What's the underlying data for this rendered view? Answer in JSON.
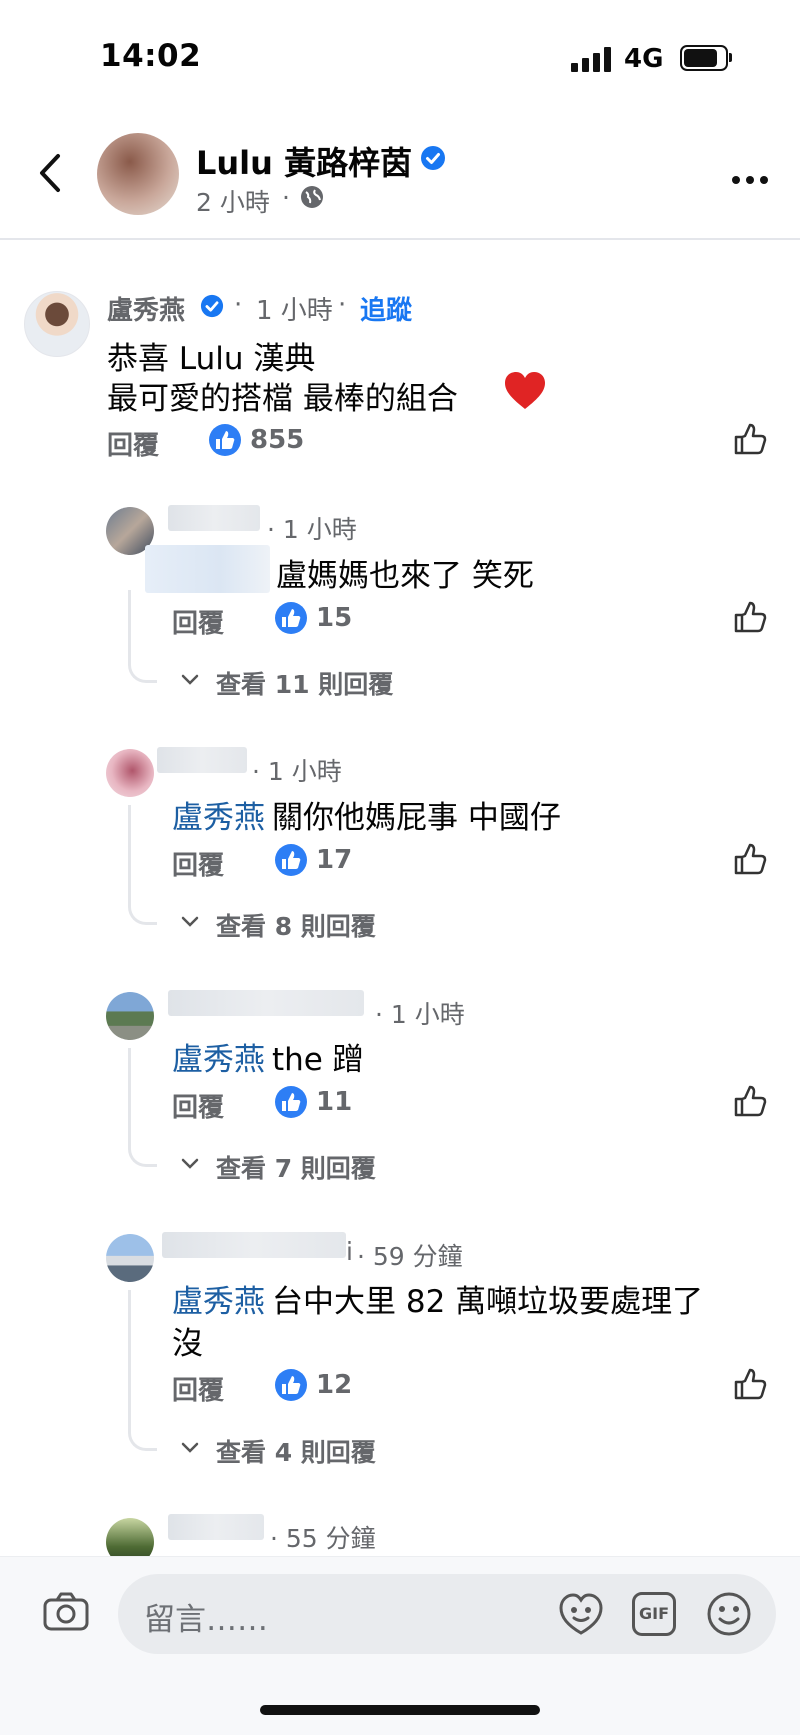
{
  "status_bar": {
    "time": "14:02",
    "network": "4G"
  },
  "post_header": {
    "author": "Lulu 黃路梓茵",
    "time": "2 小時",
    "separator": "·",
    "icons": {
      "back": "back-arrow-icon",
      "verified": "verified-badge-icon",
      "audience": "globe-icon",
      "more": "more-options-icon"
    }
  },
  "top_comment": {
    "author": "盧秀燕",
    "time": "1 小時",
    "follow_label": "追蹤",
    "text_line1": "恭喜 Lulu 漢典",
    "text_line2": "最可愛的搭檔 最棒的組合",
    "reply_label": "回覆",
    "likes": "855"
  },
  "replies": [
    {
      "name_tail": "",
      "time": "· 1 小時",
      "mention": "",
      "text": "盧媽媽也來了 笑死",
      "text2": "",
      "reply_label": "回覆",
      "likes": "15",
      "view_replies": "查看 11 則回覆"
    },
    {
      "name_tail": "",
      "time": "· 1 小時",
      "mention": "盧秀燕",
      "text": " 關你他媽屁事 中國仔",
      "text2": "",
      "reply_label": "回覆",
      "likes": "17",
      "view_replies": "查看 8 則回覆"
    },
    {
      "name_tail": "",
      "time": "· 1 小時",
      "mention": "盧秀燕",
      "text": " the 蹭",
      "text2": "",
      "reply_label": "回覆",
      "likes": "11",
      "view_replies": "查看 7 則回覆"
    },
    {
      "name_tail": "i",
      "time": "· 59 分鐘",
      "mention": "盧秀燕",
      "text": " 台中大里 82 萬噸垃圾要處理了",
      "text2": "沒",
      "reply_label": "回覆",
      "likes": "12",
      "view_replies": "查看 4 則回覆"
    },
    {
      "name_tail": "",
      "time": "· 55 分鐘"
    }
  ],
  "composer": {
    "placeholder": "留言……",
    "gif_label": "GIF"
  },
  "colors": {
    "accent": "#1877f2",
    "like_badge": "#2d7ef5",
    "mention": "#1d5fa3",
    "heart": "#e02424"
  }
}
